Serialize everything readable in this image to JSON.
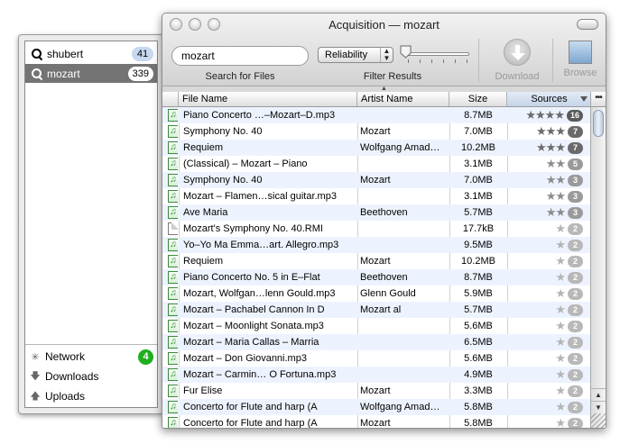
{
  "window": {
    "title": "Acquisition — mozart"
  },
  "drawer": {
    "searches": [
      {
        "label": "shubert",
        "count": "41"
      },
      {
        "label": "mozart",
        "count": "339"
      }
    ],
    "nav": [
      {
        "label": "Network",
        "icon": "network-icon",
        "badge": "4"
      },
      {
        "label": "Downloads",
        "icon": "downloads-arrow-icon"
      },
      {
        "label": "Uploads",
        "icon": "uploads-arrow-icon"
      }
    ]
  },
  "toolbar": {
    "search_value": "mozart",
    "search_label": "Search for Files",
    "filter_select": "Reliability",
    "filter_label": "Filter Results",
    "download_label": "Download",
    "browse_label": "Browse"
  },
  "table": {
    "columns": {
      "name": "File Name",
      "artist": "Artist Name",
      "size": "Size",
      "sources": "Sources"
    },
    "more_button": "•••",
    "rows": [
      {
        "name": "Piano Concerto …–Mozart–D.mp3",
        "artist": "",
        "size": "8.7MB",
        "stars": 4,
        "sources": "16",
        "type": "audio"
      },
      {
        "name": "Symphony No. 40",
        "artist": "Mozart",
        "size": "7.0MB",
        "stars": 3,
        "sources": "7",
        "type": "audio"
      },
      {
        "name": "Requiem",
        "artist": "Wolfgang Amad…",
        "size": "10.2MB",
        "stars": 3,
        "sources": "7",
        "type": "audio"
      },
      {
        "name": "(Classical) – Mozart – Piano",
        "artist": "",
        "size": "3.1MB",
        "stars": 2,
        "sources": "5",
        "type": "audio"
      },
      {
        "name": "Symphony No. 40",
        "artist": "Mozart",
        "size": "7.0MB",
        "stars": 2,
        "sources": "3",
        "type": "audio"
      },
      {
        "name": "Mozart – Flamen…sical guitar.mp3",
        "artist": "",
        "size": "3.1MB",
        "stars": 2,
        "sources": "3",
        "type": "audio"
      },
      {
        "name": "Ave Maria",
        "artist": "Beethoven",
        "size": "5.7MB",
        "stars": 2,
        "sources": "3",
        "type": "audio"
      },
      {
        "name": "Mozart's Symphony No. 40.RMI",
        "artist": "",
        "size": "17.7kB",
        "stars": 1,
        "sources": "2",
        "type": "plain"
      },
      {
        "name": "Yo–Yo Ma Emma…art. Allegro.mp3",
        "artist": "",
        "size": "9.5MB",
        "stars": 1,
        "sources": "2",
        "type": "audio"
      },
      {
        "name": "Requiem",
        "artist": "Mozart",
        "size": "10.2MB",
        "stars": 1,
        "sources": "2",
        "type": "audio"
      },
      {
        "name": "Piano Concerto No. 5 in E–Flat",
        "artist": "Beethoven",
        "size": "8.7MB",
        "stars": 1,
        "sources": "2",
        "type": "audio"
      },
      {
        "name": "Mozart, Wolfgan…lenn Gould.mp3",
        "artist": "Glenn Gould",
        "size": "5.9MB",
        "stars": 1,
        "sources": "2",
        "type": "audio"
      },
      {
        "name": "Mozart – Pachabel Cannon In D",
        "artist": "Mozart al",
        "size": "5.7MB",
        "stars": 1,
        "sources": "2",
        "type": "audio"
      },
      {
        "name": "Mozart – Moonlight Sonata.mp3",
        "artist": "",
        "size": "5.6MB",
        "stars": 1,
        "sources": "2",
        "type": "audio"
      },
      {
        "name": "Mozart – Maria Callas – Marria",
        "artist": "",
        "size": "6.5MB",
        "stars": 1,
        "sources": "2",
        "type": "audio"
      },
      {
        "name": "Mozart – Don Giovanni.mp3",
        "artist": "",
        "size": "5.6MB",
        "stars": 1,
        "sources": "2",
        "type": "audio"
      },
      {
        "name": "Mozart – Carmin… O Fortuna.mp3",
        "artist": "",
        "size": "4.9MB",
        "stars": 1,
        "sources": "2",
        "type": "audio"
      },
      {
        "name": "Fur Elise",
        "artist": "Mozart",
        "size": "3.3MB",
        "stars": 1,
        "sources": "2",
        "type": "audio"
      },
      {
        "name": "Concerto for Flute and harp (A",
        "artist": "Wolfgang Amad…",
        "size": "5.8MB",
        "stars": 1,
        "sources": "2",
        "type": "audio"
      },
      {
        "name": "Concerto for Flute and harp (A",
        "artist": "Mozart",
        "size": "5.8MB",
        "stars": 1,
        "sources": "2",
        "type": "audio"
      }
    ]
  },
  "colors": {
    "selection_gray": "#747474",
    "row_alt": "#edf3fe",
    "count_badge": "#c6d9ef",
    "network_badge": "#1fae1f",
    "star_dark": "#6a6a6a",
    "star_medium": "#8c8c8c",
    "star_light": "#b4b4b4"
  }
}
